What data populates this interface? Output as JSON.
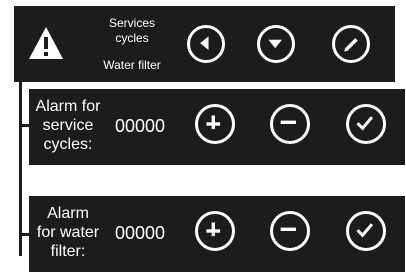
{
  "top_panel": {
    "icon": "warning-icon",
    "services_label": "Services",
    "cycles_label": "cycles",
    "water_filter_label": "Water filter",
    "buttons": [
      "back-arrow-icon",
      "dropdown-arrow-icon",
      "edit-pencil-icon"
    ]
  },
  "row_service": {
    "label_line1": "Alarm for",
    "label_line2": "service",
    "label_line3": "cycles:",
    "value": "00000",
    "buttons": [
      "plus-icon",
      "minus-icon",
      "check-icon"
    ]
  },
  "row_filter": {
    "label_line1": "Alarm",
    "label_line2": "for water",
    "label_line3": "filter:",
    "value": "00000",
    "buttons": [
      "plus-icon",
      "minus-icon",
      "check-icon"
    ]
  },
  "colors": {
    "panel": "#1c1c1c",
    "foreground": "#ffffff"
  }
}
